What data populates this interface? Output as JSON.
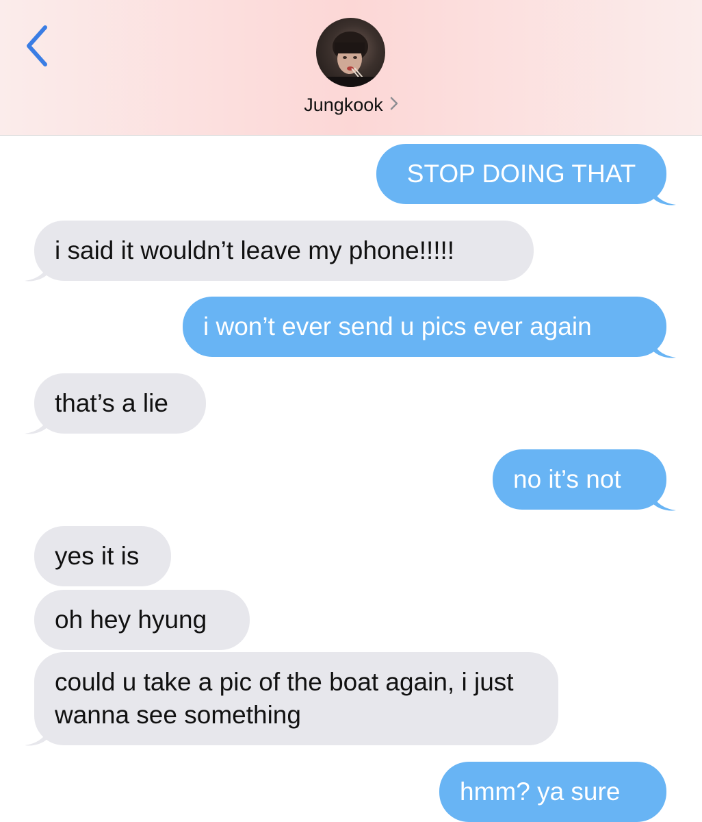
{
  "header": {
    "contact_name": "Jungkook",
    "back_icon": "chevron-left-icon",
    "name_chevron_icon": "chevron-right-icon"
  },
  "colors": {
    "sent_bubble": "#68b4f4",
    "received_bubble": "#e7e7ec",
    "accent": "#3a7de4"
  },
  "messages": [
    {
      "direction": "sent",
      "text": "STOP DOING THAT"
    },
    {
      "direction": "received",
      "text": "i said it wouldn’t leave my phone!!!!!"
    },
    {
      "direction": "sent",
      "text": "i won’t ever send u pics ever again"
    },
    {
      "direction": "received",
      "text": "that’s a lie"
    },
    {
      "direction": "sent",
      "text": "no it’s not"
    },
    {
      "direction": "received",
      "text": "yes it is"
    },
    {
      "direction": "received",
      "text": "oh hey hyung"
    },
    {
      "direction": "received",
      "text": "could u take a pic of the boat again, i just wanna see something"
    },
    {
      "direction": "sent",
      "text": "hmm? ya sure"
    }
  ]
}
